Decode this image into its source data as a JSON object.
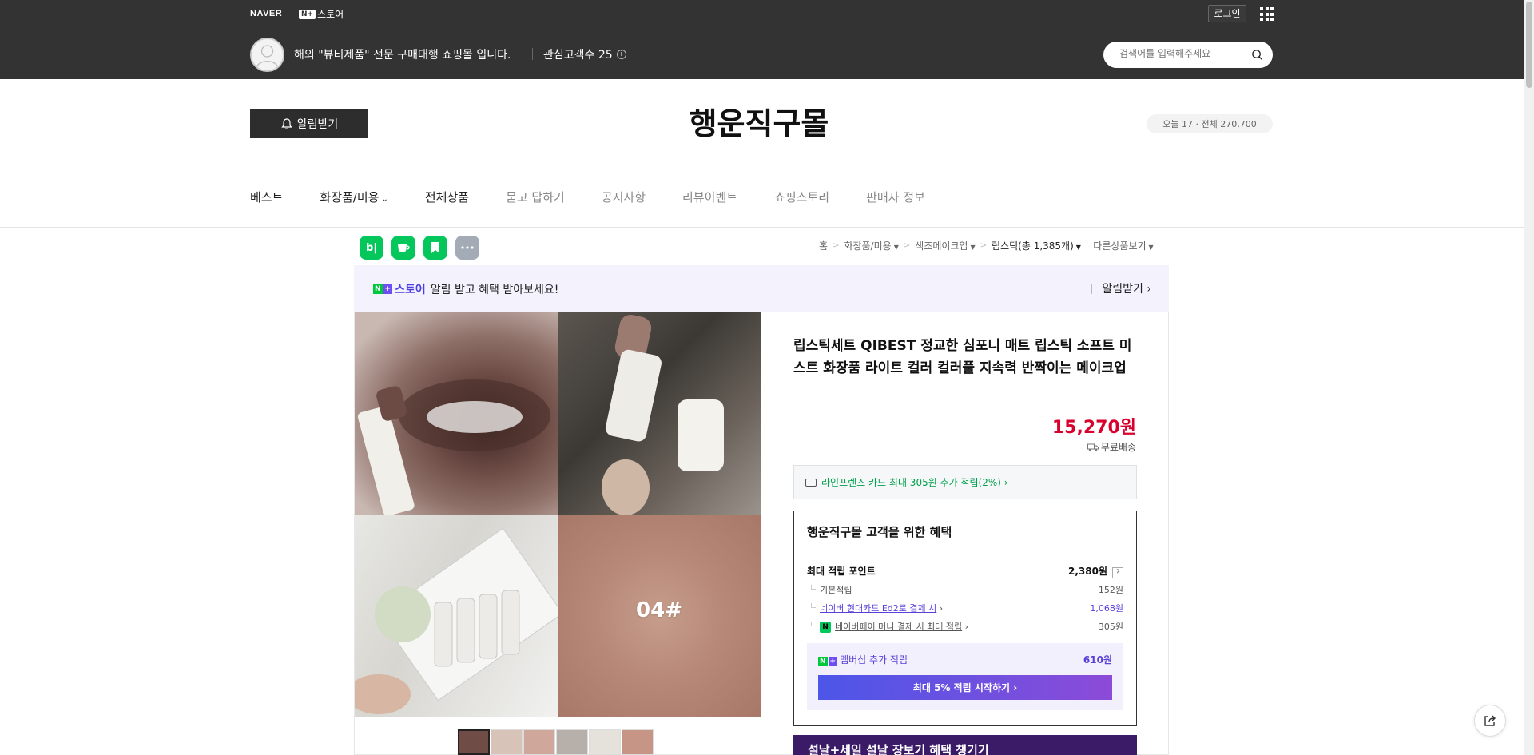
{
  "header": {
    "naver_logo": "NAVER",
    "nplus_badge": "N+",
    "store_label": "스토어",
    "login": "로그인",
    "shop_description": "해외 \"뷰티제품\" 전문 구매대행 쇼핑몰 입니다.",
    "interest_label": "관심고객수 25",
    "search_placeholder": "검색어를 입력해주세요"
  },
  "store": {
    "alarm_button": "알림받기",
    "title": "행운직구몰",
    "visit_count": "오늘 17 · 전체 270,700"
  },
  "nav": {
    "items": [
      "베스트",
      "화장품/미용",
      "전체상품",
      "묻고 답하기",
      "공지사항",
      "리뷰이벤트",
      "쇼핑스토리",
      "판매자 정보"
    ]
  },
  "share": {
    "icons": [
      "blog-icon",
      "cafe-icon",
      "bookmark-icon",
      "more-icon"
    ],
    "blog_label": "b|"
  },
  "breadcrumb": {
    "home": "홈",
    "cat1": "화장품/미용",
    "cat2": "색조메이크업",
    "cat3": "립스틱(총 1,385개)",
    "other": "다른상품보기"
  },
  "alarm_banner": {
    "n_badge": "N",
    "plus_badge": "+",
    "store_label": "스토어",
    "text": "알림 받고 혜택 받아보세요!",
    "action": "알림받기 ›"
  },
  "gallery": {
    "photo4_label": "04#",
    "thumbnail_count": 6
  },
  "product": {
    "title": "립스틱세트 QIBEST 정교한 심포니 매트 립스틱 소프트 미스트 화장품 라이트 컬러 컬러풀 지속력 반짝이는 메이크업",
    "price": "15,270원",
    "shipping": "무료배송",
    "card_benefit": "라인프렌즈 카드 최대 305원 추가 적립(2%) ›"
  },
  "benefits": {
    "title": "행운직구몰 고객을 위한 혜택",
    "max_points_label": "최대 적립 포인트",
    "max_points_value": "2,380원",
    "help_label": "?",
    "basic_label": "기본적립",
    "basic_value": "152원",
    "card_label": "네이버 현대카드 Ed2로 결제 시",
    "card_value": "1,068원",
    "npay_badge": "N",
    "npay_label": "네이버페이 머니 결제 시 최대 적립",
    "npay_value": "305원",
    "membership_label": "멤버십 추가 적립",
    "membership_value": "610원",
    "membership_button": "최대 5% 적립 시작하기 ›"
  },
  "promo": {
    "text": "설날+세일    설날 장보기 혜택 챙기기"
  },
  "colors": {
    "topbar": "#333333",
    "price": "#d8002c",
    "green": "#00c73c",
    "purple": "#5a3fd8"
  }
}
